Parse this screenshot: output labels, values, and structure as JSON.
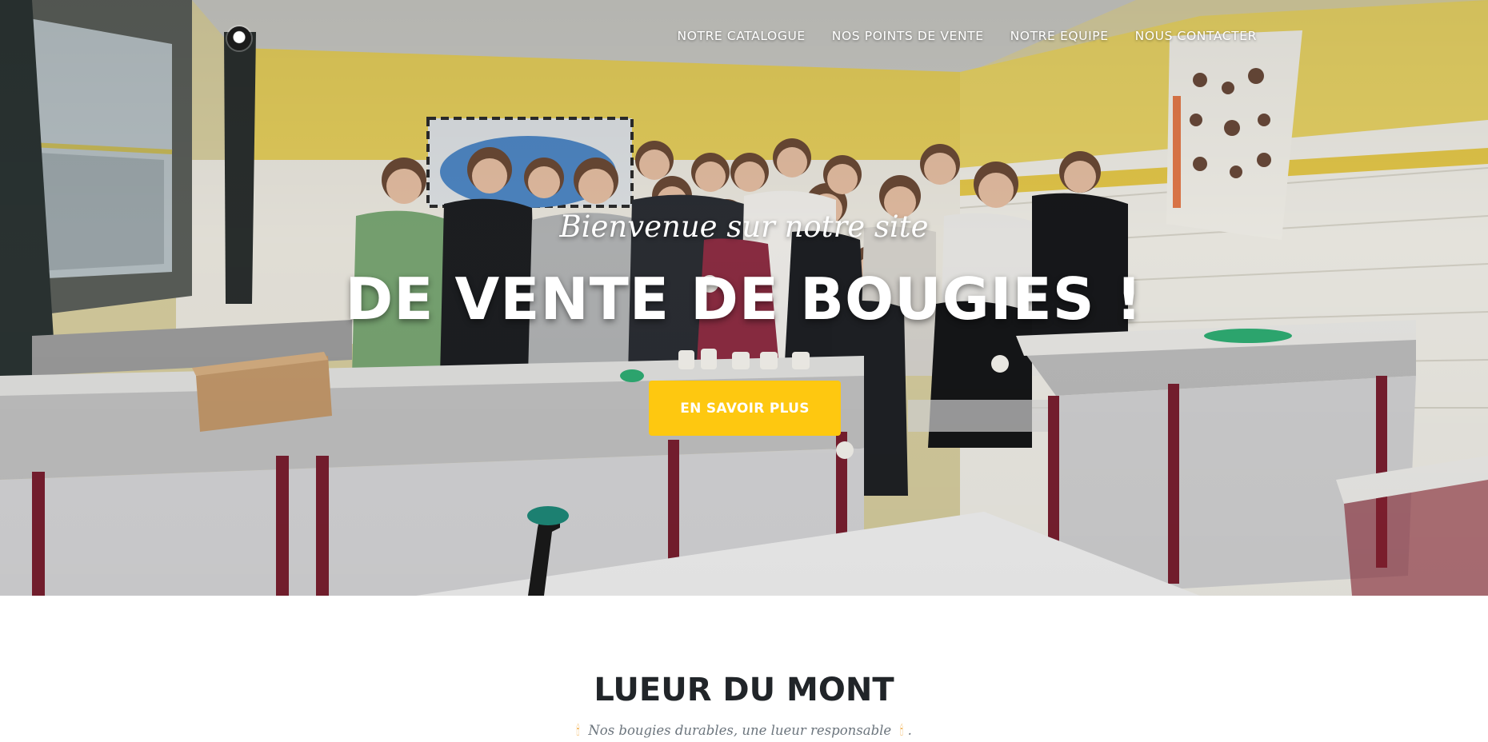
{
  "nav": {
    "items": [
      {
        "label": "NOTRE CATALOGUE"
      },
      {
        "label": "NOS POINTS DE VENTE"
      },
      {
        "label": "NOTRE EQUIPE"
      },
      {
        "label": "NOUS CONTACTER"
      }
    ]
  },
  "hero": {
    "subheading": "Bienvenue sur notre site",
    "heading": "DE VENTE DE BOUGIES !",
    "cta_label": "EN SAVOIR PLUS"
  },
  "about": {
    "title": "LUEUR DU MONT",
    "tagline": "Nos bougies durables, une lueur responsable",
    "tagline_end": "."
  },
  "colors": {
    "accent": "#fec810",
    "text_dark": "#212529",
    "text_muted": "#6c757d"
  },
  "icons": {
    "logo": "logo-icon",
    "flame_left": "candle-flame-icon",
    "flame_right": "candle-flame-icon"
  }
}
